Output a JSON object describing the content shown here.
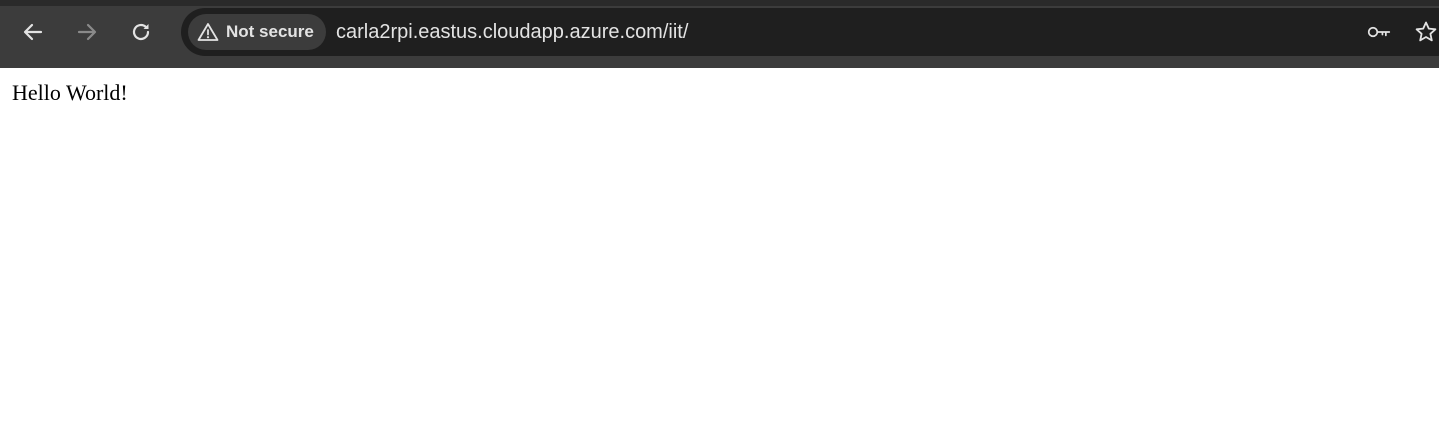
{
  "browser": {
    "security_chip": {
      "label": "Not secure",
      "icon": "warning-triangle-icon"
    },
    "address_bar": {
      "url": "carla2rpi.eastus.cloudapp.azure.com/iit/"
    },
    "nav": {
      "back_icon": "arrow-left-icon",
      "forward_icon": "arrow-right-icon",
      "reload_icon": "reload-icon"
    },
    "omnibox_actions": {
      "password_icon": "key-icon",
      "bookmark_icon": "star-icon"
    },
    "colors": {
      "toolbar_bg": "#3c3c3c",
      "omnibox_bg": "#1f1f1f",
      "text": "#e3e3e3"
    }
  },
  "page": {
    "body_text": "Hello World!"
  }
}
